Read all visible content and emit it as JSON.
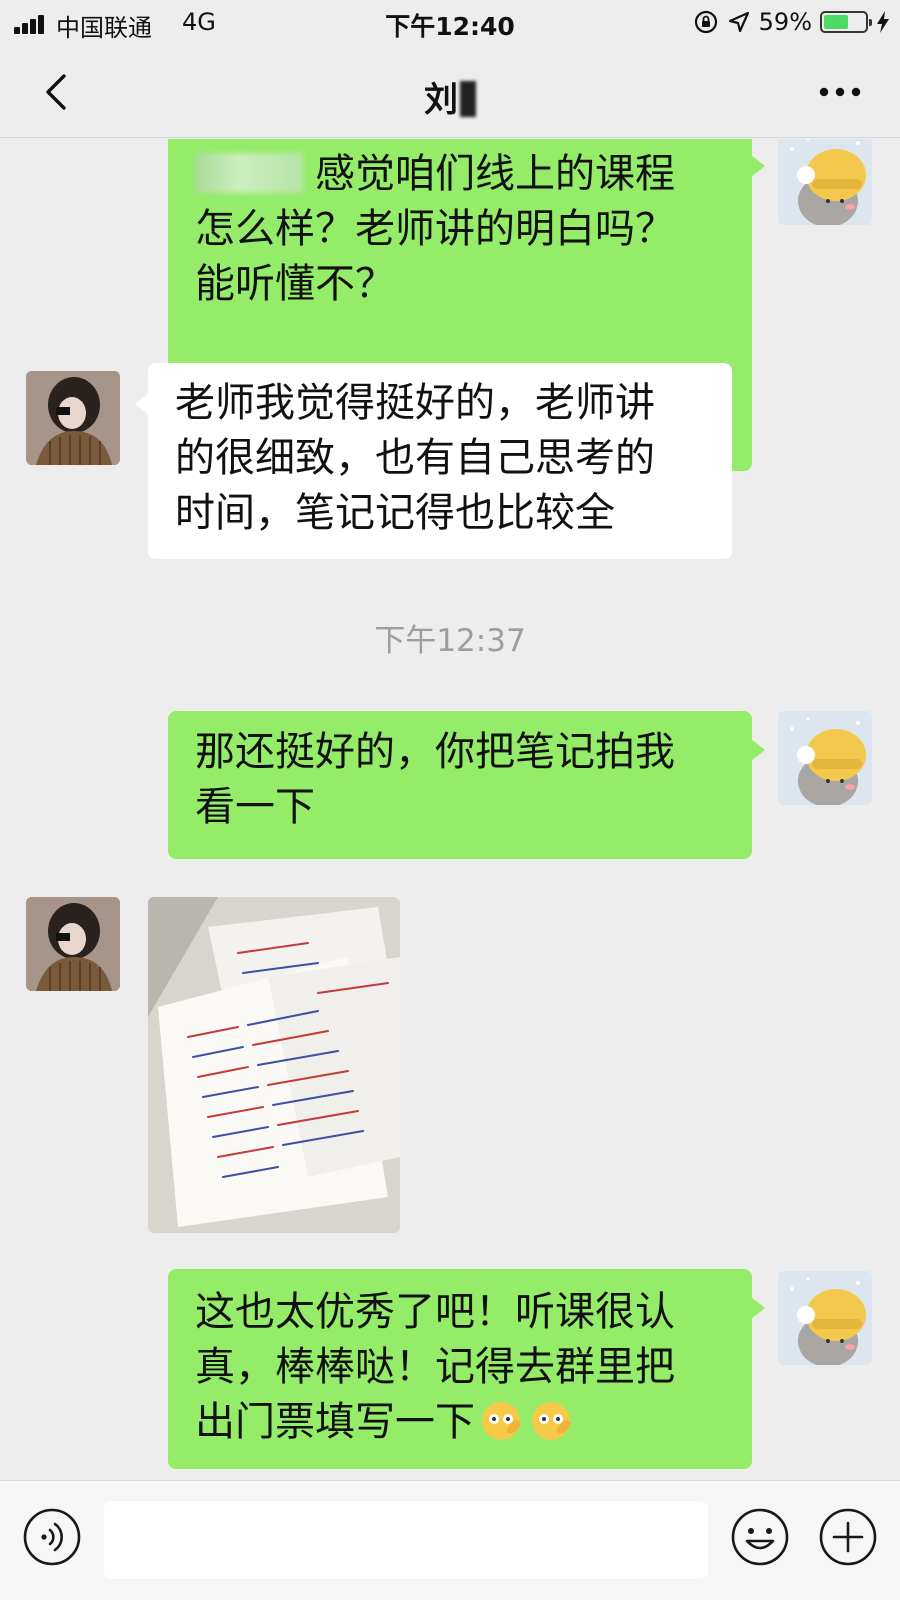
{
  "status_bar": {
    "carrier": "中国联通",
    "network": "4G",
    "time": "下午12:40",
    "battery": "59%",
    "battery_level": 0.59,
    "icons": [
      "signal-icon",
      "orientation-lock-icon",
      "location-icon",
      "battery-icon",
      "charging-icon"
    ]
  },
  "nav": {
    "title": "刘",
    "back_icon": "chevron-left-icon",
    "more_icon": "more-dots-icon"
  },
  "messages": [
    {
      "from": "me",
      "type": "text",
      "lines": [
        "感觉咱们线上的课程",
        "怎么样？老师讲的明白吗？",
        "能听懂不？"
      ]
    },
    {
      "from": "other",
      "type": "text",
      "lines": [
        "老师我觉得挺好的，老师讲",
        "的很细致，也有自己思考的",
        "时间，笔记记得也比较全"
      ]
    },
    {
      "type": "timestamp",
      "text": "下午12:37"
    },
    {
      "from": "me",
      "type": "text",
      "lines": [
        "那还挺好的，你把笔记拍我",
        "看一下"
      ]
    },
    {
      "from": "other",
      "type": "image",
      "description_icon": "notes-photo"
    },
    {
      "from": "me",
      "type": "text",
      "lines": [
        "这也太优秀了吧！听课很认",
        "真，棒棒哒！记得去群里把",
        "出门票填写一下"
      ],
      "emoji_count": 2
    }
  ],
  "input_bar": {
    "voice_icon": "voice-icon",
    "emoji_icon": "smiley-icon",
    "plus_icon": "plus-circle-icon"
  },
  "colors": {
    "background": "#ededed",
    "bubble_out": "#95ec69",
    "bubble_in": "#ffffff",
    "timestamp": "#9d9d9d"
  }
}
